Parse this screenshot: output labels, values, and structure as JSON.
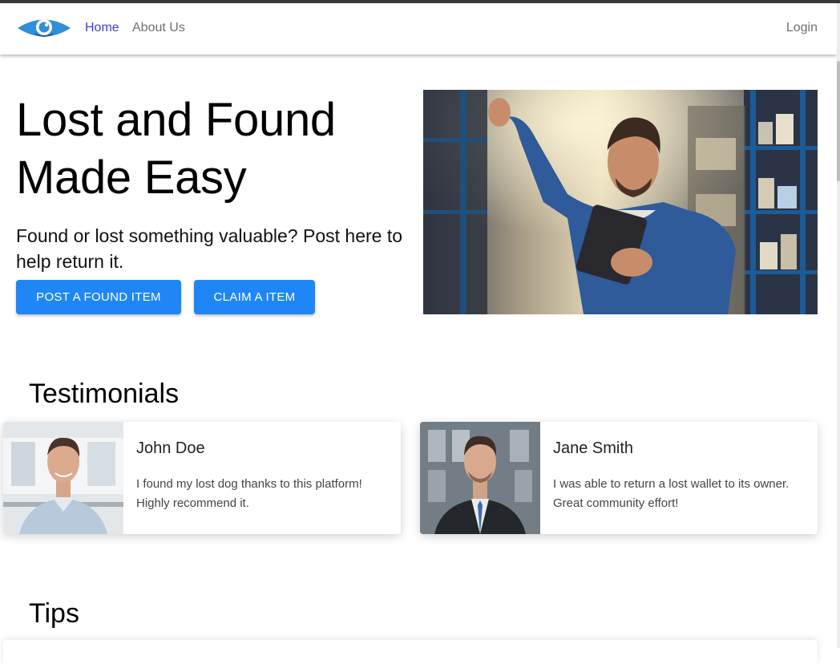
{
  "nav": {
    "home": "Home",
    "about": "About Us",
    "login": "Login",
    "logo_icon": "eye-logo-icon"
  },
  "hero": {
    "title": "Lost and Found Made Easy",
    "subtitle": "Found or lost something valuable? Post here to help return it.",
    "post_button": "POST A FOUND ITEM",
    "claim_button": "CLAIM A ITEM"
  },
  "testimonials": {
    "heading": "Testimonials",
    "items": [
      {
        "name": "John Doe",
        "text": "I found my lost dog thanks to this platform! Highly recommend it."
      },
      {
        "name": "Jane Smith",
        "text": "I was able to return a lost wallet to its owner. Great community effort!"
      }
    ]
  },
  "tips": {
    "heading": "Tips"
  },
  "colors": {
    "primary": "#1e87f5",
    "active_link": "#3b3fd6",
    "muted_link": "#6f6f6f",
    "logo": "#2f8fd8"
  }
}
